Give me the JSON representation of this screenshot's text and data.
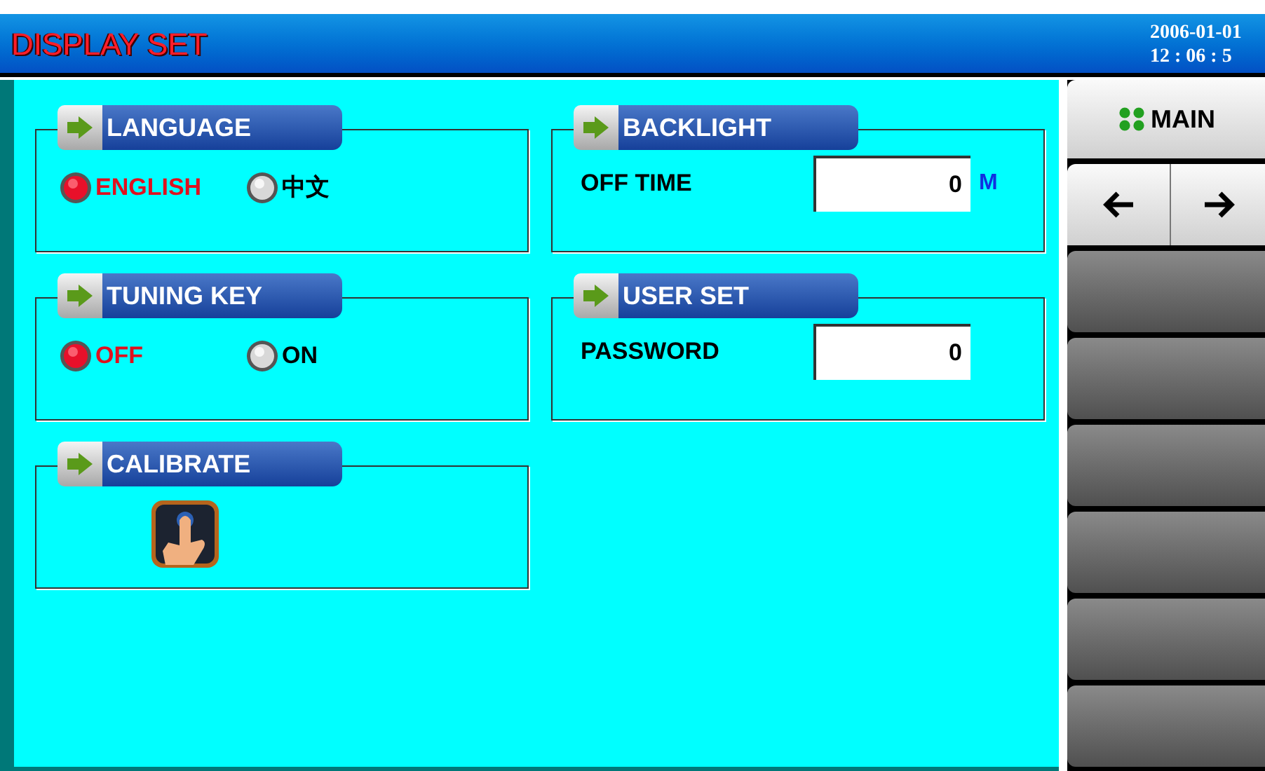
{
  "title_bar": {
    "title": "DISPLAY SET",
    "date": "2006-01-01",
    "time": "12 : 06 : 5"
  },
  "groups": [
    {
      "title": "LANGUAGE",
      "kind": "radios",
      "options": [
        {
          "label": "ENGLISH",
          "selected": true
        },
        {
          "label": "中文",
          "selected": false
        }
      ]
    },
    {
      "title": "BACKLIGHT",
      "kind": "field",
      "label": "OFF TIME",
      "value": "0",
      "unit": "M"
    },
    {
      "title": "TUNING KEY",
      "kind": "radios",
      "options": [
        {
          "label": "OFF",
          "selected": true
        },
        {
          "label": "ON",
          "selected": false
        }
      ]
    },
    {
      "title": "USER SET",
      "kind": "field",
      "label": "PASSWORD",
      "value": "0"
    },
    {
      "title": "CALIBRATE",
      "kind": "touch"
    }
  ],
  "sidebar": {
    "buttons": [
      {
        "kind": "main",
        "label": "MAIN"
      },
      {
        "kind": "arrows"
      },
      {
        "kind": "blank"
      },
      {
        "kind": "blank"
      },
      {
        "kind": "blank"
      },
      {
        "kind": "blank"
      },
      {
        "kind": "blank"
      },
      {
        "kind": "blank"
      }
    ]
  }
}
